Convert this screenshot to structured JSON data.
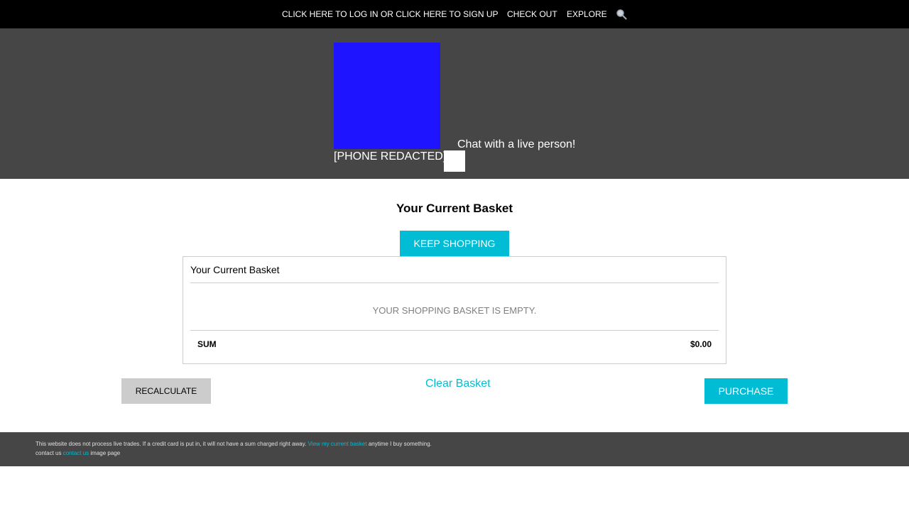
{
  "topnav": {
    "login_label": "CLICK HERE TO LOG IN OR CLICK HERE TO SIGN UP",
    "checkout_label": "CHECK OUT",
    "explore_label": "EXPLORE",
    "search_icon": "search-icon"
  },
  "header": {
    "logo_color": "#1e14ff",
    "phone": "[PHONE REDACTED]",
    "chat_label": "Chat with a live person!"
  },
  "basket": {
    "heading": "Your Current Basket",
    "keep_shopping_label": "KEEP SHOPPING",
    "table_title": "Your Current Basket",
    "empty_message": "YOUR SHOPPING BASKET IS EMPTY.",
    "sum_label": "SUM",
    "sum_value": "$0.00",
    "recalculate_label": "RECALCULATE",
    "clear_label": "Clear Basket",
    "purchase_label": "PURCHASE"
  },
  "footer": {
    "notice": "This website does not process live trades. If a credit card is put in, it will not have a sum charged right away.",
    "basket_link": "View my current basket",
    "notice_suffix": "anytime I buy something.",
    "contact_prefix": "contact us",
    "contact_link": "contact us",
    "contact_suffix": "image page"
  },
  "colors": {
    "accent": "#00bcd4",
    "header_bg": "#464646",
    "nav_bg": "#000000"
  }
}
